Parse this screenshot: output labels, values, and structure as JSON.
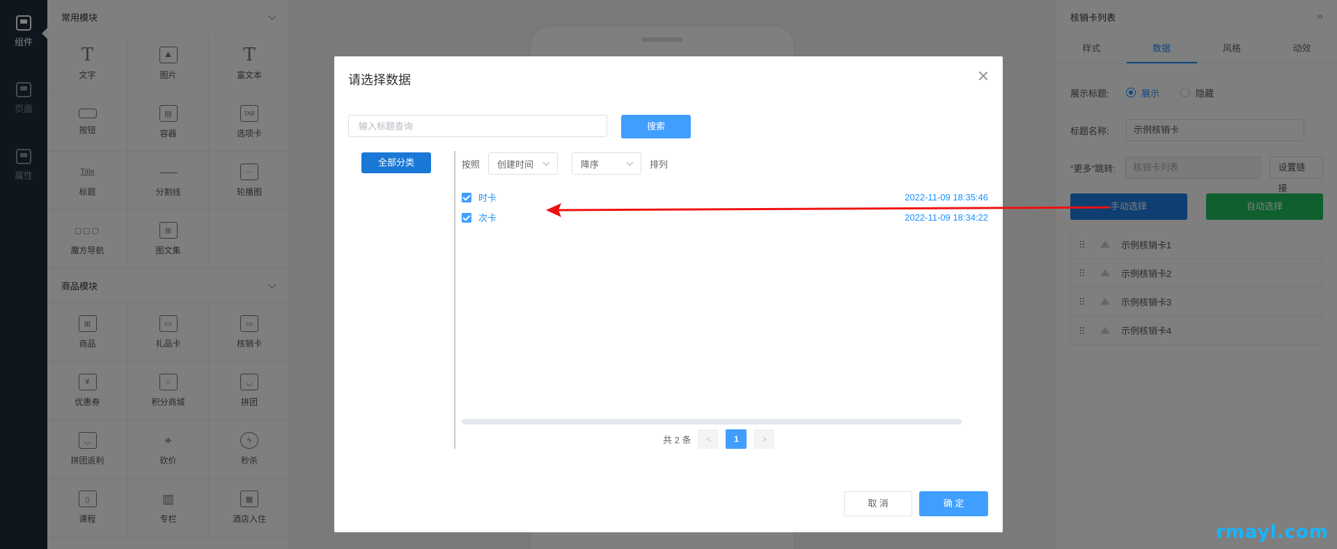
{
  "rail": {
    "items": [
      {
        "label": "组件",
        "active": true
      },
      {
        "label": "页面",
        "active": false
      },
      {
        "label": "属性",
        "active": false
      }
    ]
  },
  "components": {
    "common_title": "常用模块",
    "common_items": [
      "文字",
      "图片",
      "富文本",
      "按钮",
      "容器",
      "选项卡",
      "标题",
      "分割线",
      "轮播图",
      "魔方导航",
      "图文集"
    ],
    "goods_title": "商品模块",
    "goods_items": [
      "商品",
      "礼品卡",
      "核销卡",
      "优惠券",
      "积分商城",
      "拼团",
      "拼团返利",
      "砍价",
      "秒杀",
      "课程",
      "专栏",
      "酒店入住"
    ],
    "icon_glyphs": {
      "title_icon_text": "Title",
      "tab_icon_text": "TAB"
    }
  },
  "settings": {
    "title": "核销卡列表",
    "tabs": [
      "样式",
      "数据",
      "风格",
      "动效"
    ],
    "active_tab": 1,
    "show_title_label": "展示标题:",
    "show_option": "展示",
    "hide_option": "隐藏",
    "title_name_label": "标题名称:",
    "title_name_value": "示例核销卡",
    "more_link_label": "\"更多\"跳转:",
    "more_link_placeholder": "核销卡列表",
    "set_link_button": "设置链接",
    "manual_select": "手动选择",
    "auto_select": "自动选择",
    "cards": [
      "示例核销卡1",
      "示例核销卡2",
      "示例核销卡3",
      "示例核销卡4"
    ]
  },
  "modal": {
    "title": "请选择数据",
    "search_placeholder": "输入标题查询",
    "search_button": "搜索",
    "category_button": "全部分类",
    "sort_by_label": "按照",
    "sort_field": "创建时间",
    "sort_order": "降序",
    "sort_suffix": "排列",
    "rows": [
      {
        "name": "时卡",
        "time": "2022-11-09 18:35:46",
        "checked": true
      },
      {
        "name": "次卡",
        "time": "2022-11-09 18:34:22",
        "checked": true
      }
    ],
    "total_text": "共 2 条",
    "current_page": "1",
    "cancel_button": "取 消",
    "confirm_button": "确 定"
  },
  "colors": {
    "primary": "#409eff",
    "manual_btn": "#1c7fe0",
    "auto_btn": "#1fbf5f",
    "arrow": "#ee1111"
  },
  "watermark": "rmayl.com"
}
